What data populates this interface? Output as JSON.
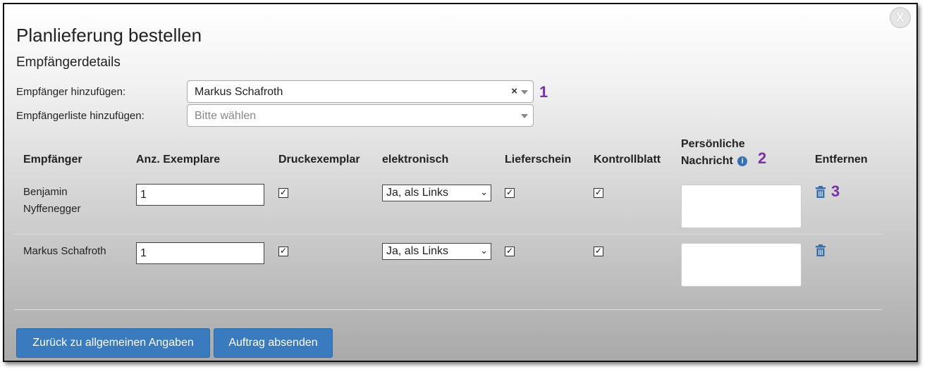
{
  "dialog": {
    "close_label": "X",
    "title": "Planlieferung bestellen",
    "subtitle": "Empfängerdetails"
  },
  "form": {
    "add_recipient_label": "Empfänger hinzufügen:",
    "add_recipient_value": "Markus Schafroth",
    "add_recipient_clear": "×",
    "add_list_label": "Empfängerliste hinzufügen:",
    "add_list_placeholder": "Bitte wählen"
  },
  "markers": {
    "m1": "1",
    "m2": "2",
    "m3": "3"
  },
  "table": {
    "headers": {
      "recipient": "Empfänger",
      "copies": "Anz. Exemplare",
      "print": "Druckexemplar",
      "electronic": "elektronisch",
      "delivery_note": "Lieferschein",
      "control_sheet": "Kontrollblatt",
      "message_line1": "Persönliche",
      "message_line2": "Nachricht",
      "remove": "Entfernen"
    },
    "rows": [
      {
        "name_line1": "Benjamin",
        "name_line2": "Nyffenegger",
        "copies": "1",
        "print": true,
        "electronic": "Ja, als Links",
        "delivery_note": true,
        "control_sheet": true,
        "message": ""
      },
      {
        "name_line1": "Markus Schafroth",
        "name_line2": "",
        "copies": "1",
        "print": true,
        "electronic": "Ja, als Links",
        "delivery_note": true,
        "control_sheet": true,
        "message": ""
      }
    ]
  },
  "buttons": {
    "back": "Zurück zu allgemeinen Angaben",
    "submit": "Auftrag absenden"
  },
  "icons": {
    "info": "info-icon",
    "trash": "trash-icon",
    "close": "close-icon"
  },
  "colors": {
    "primary_button": "#3a7bbf",
    "marker": "#7b2fa8",
    "trash_icon": "#3a6ea8",
    "info_icon": "#3570b4"
  }
}
